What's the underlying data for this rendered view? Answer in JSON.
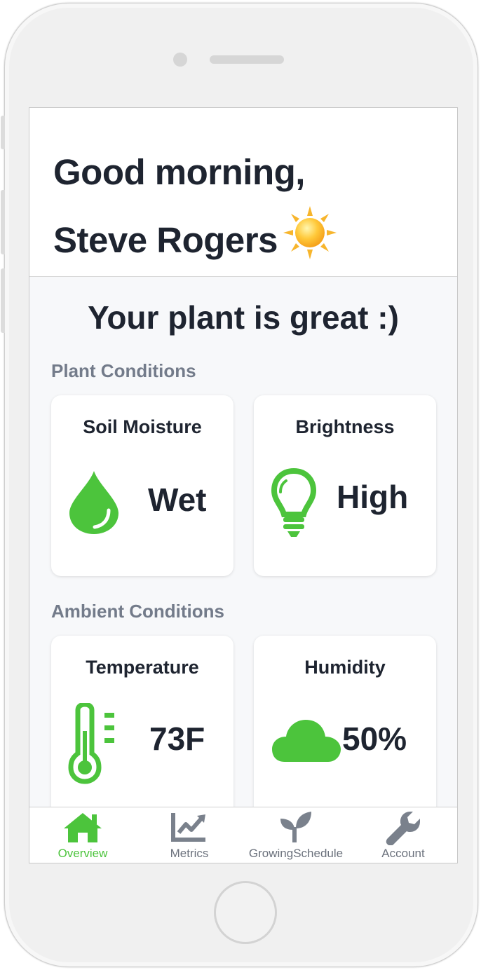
{
  "header": {
    "greeting_line1": "Good morning,",
    "greeting_line2": "Steve Rogers"
  },
  "status": {
    "message": "Your plant is great :)"
  },
  "sections": {
    "plant_conditions": "Plant Conditions",
    "ambient_conditions": "Ambient Conditions"
  },
  "cards": {
    "soil_moisture": {
      "title": "Soil Moisture",
      "value": "Wet",
      "icon": "water-drop-icon"
    },
    "brightness": {
      "title": "Brightness",
      "value": "High",
      "icon": "light-bulb-icon"
    },
    "temperature": {
      "title": "Temperature",
      "value": "73F",
      "icon": "thermometer-icon"
    },
    "humidity": {
      "title": "Humidity",
      "value": "50%",
      "icon": "cloud-icon"
    }
  },
  "tabs": [
    {
      "label": "Overview",
      "icon": "home-icon",
      "active": true
    },
    {
      "label": "Metrics",
      "icon": "chart-icon",
      "active": false
    },
    {
      "label": "GrowingSchedule",
      "icon": "sprout-icon",
      "active": false
    },
    {
      "label": "Account",
      "icon": "wrench-icon",
      "active": false
    }
  ],
  "colors": {
    "accent": "#4cc43c",
    "text_dark": "#1e2430",
    "text_muted": "#737b8a",
    "tab_inactive": "#6b717c"
  }
}
